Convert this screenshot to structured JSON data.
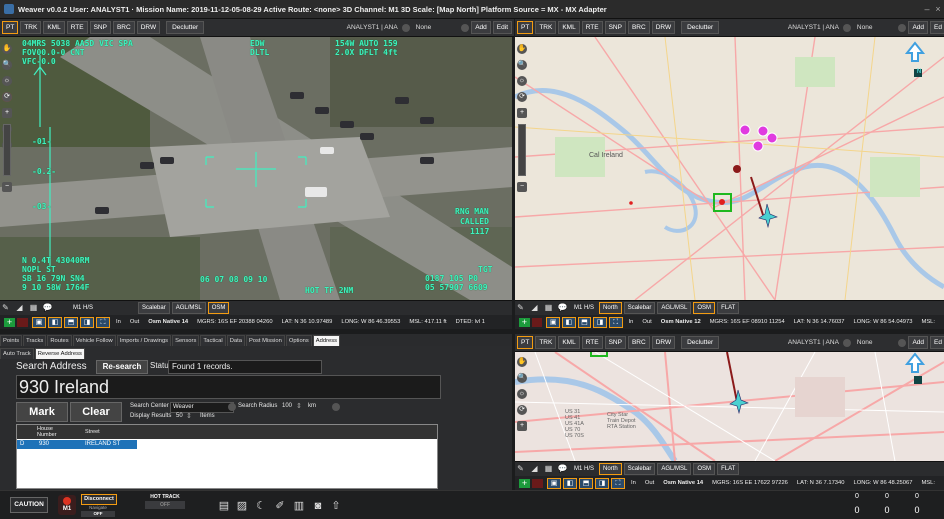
{
  "titlebar": {
    "text": "Weaver v0.0.2    User: ANALYST1 · Mission Name: 2019-11-12-05-08-29    Active Route: <none>  3D Channel: M1  3D Scale:   [Map North] Platform Source = MX - MX Adapter"
  },
  "left_toolbar": {
    "buttons": [
      "PT",
      "TRK",
      "KML",
      "RTE",
      "SNP",
      "BRC",
      "DRW"
    ],
    "declutter": "Declutter",
    "analyst": "ANALYST1 | ANA",
    "none": "None",
    "add": "Add",
    "edit": "Edit"
  },
  "right_toolbar": {
    "buttons": [
      "PT",
      "TRK",
      "KML",
      "RTE",
      "SNP",
      "BRC",
      "DRW"
    ],
    "declutter": "Declutter",
    "analyst": "ANALYST1 | ANA",
    "none": "None",
    "add": "Add",
    "edit": "Ed"
  },
  "right_toolbar2": {
    "buttons": [
      "PT",
      "TRK",
      "KML",
      "RTE",
      "SNP",
      "BRC",
      "DRW"
    ],
    "declutter": "Declutter",
    "analyst": "ANALYST1 | ANA",
    "none": "None",
    "add": "Add",
    "edit": "Ed"
  },
  "video_hud": {
    "tl1": "04MRS 5038  AA5D    VIC      SPA",
    "tl2": "FOV00.0-0        CNT",
    "tl3": "VFC-0.0",
    "tc1": "EDW",
    "tc2": "DLTL",
    "tr1": "154W        AUTO    159",
    "tr2": "2.0X  DFLT    4ft",
    "l1": "-01-",
    "l2": "-0.2-",
    "l3": "-03-",
    "r1": "RNG MAN",
    "r2": "CALLED",
    "r3": "1117",
    "bl1": "N  0.4T        43040RM",
    "bl2": "NOPL ST",
    "bl3": "SB 16 79N   SN4",
    "bl4": "9 10 58W  1764F",
    "b_scale": "06    07    08    09    10",
    "br1": "TGT",
    "br2": "0187   105 P0",
    "br3": "  05   57907 6609",
    "bc": "HOT TF   2NM"
  },
  "video_controls": {
    "mh": "M1 H/S",
    "scalebar": "Scalebar",
    "aglmsl": "AGL/MSL",
    "osm": "OSM"
  },
  "video_status": {
    "in": "In",
    "out": "Out",
    "native": "Osm Native 14",
    "mgrs": "MGRS: 16S EF 20388 04260",
    "lat": "LAT: N 36 10.97489",
    "long": "LONG: W 86 46.39553",
    "msl": "MSL: 417.11 ft",
    "dted": "DTED: lvl 1"
  },
  "map1_controls": {
    "mh": "M1 H/S",
    "north": "North",
    "scalebar": "Scalebar",
    "aglmsl": "AGL/MSL",
    "osm": "OSM",
    "flat": "FLAT"
  },
  "map1_status": {
    "in": "In",
    "out": "Out",
    "native": "Osm Native 12",
    "mgrs": "MGRS: 16S EF 08910 11254",
    "lat": "LAT: N 36 14.76037",
    "long": "LONG: W 86 54.04973",
    "msl": "MSL:"
  },
  "map1_labels": {
    "cal": "Cal Ireland",
    "north": "N"
  },
  "map2_controls": {
    "mh": "M1 H/S",
    "north": "North",
    "scalebar": "Scalebar",
    "aglmsl": "AGL/MSL",
    "osm": "OSM",
    "flat": "FLAT"
  },
  "map2_status": {
    "in": "In",
    "out": "Out",
    "native": "Osm Native 14",
    "mgrs": "MGRS: 16S EE 17622 97226",
    "lat": "LAT: N 36 7.17340",
    "long": "LONG: W 86 48.25067",
    "msl": "MSL:"
  },
  "map2_labels": {
    "shields": "US 31\nUS 41\nUS 41A\nUS 70\nUS 70S",
    "station": "City Star\nTrain Depot\nRTA Station"
  },
  "tabs_row1": [
    "Points",
    "Tracks",
    "Routes",
    "Vehicle Follow",
    "Imports / Drawings",
    "Sensors",
    "Tactical",
    "Data",
    "Post Mission",
    "Options",
    "Address"
  ],
  "tabs_row2": [
    "Auto Track",
    "Reverse Address"
  ],
  "address": {
    "search_label": "Search Address",
    "research": "Re-search",
    "status_label": "Status",
    "status_value": "Found 1 records.",
    "result": "930 Ireland",
    "mark": "Mark",
    "clear": "Clear",
    "search_center_label": "Search Center",
    "search_center_value": "Weaver",
    "search_radius_label": "Search Radius",
    "search_radius_value": "100",
    "radius_unit": "km",
    "display_results_label": "Display Results",
    "display_results_value": "50",
    "items_label": "Items",
    "columns": [
      "House\nNumber",
      "Street"
    ],
    "rows": [
      {
        "marker": "D",
        "house": "930",
        "street": "IRELAND ST"
      }
    ]
  },
  "footer": {
    "caution": "CAUTION",
    "m1": "M1",
    "disconnect": "Disconnect",
    "navigate": "Navigate",
    "off": "OFF",
    "hot_track": "HOT TRACK",
    "hot_track_off": "OFF",
    "counter_labels": [
      "0",
      "0",
      "0"
    ],
    "counter_values": [
      "0",
      "0",
      "0"
    ]
  },
  "colors": {
    "accent": "#f39c12",
    "hud": "#3ff0c0",
    "selection": "#1e72b8",
    "track_marker": "#e03be0"
  }
}
